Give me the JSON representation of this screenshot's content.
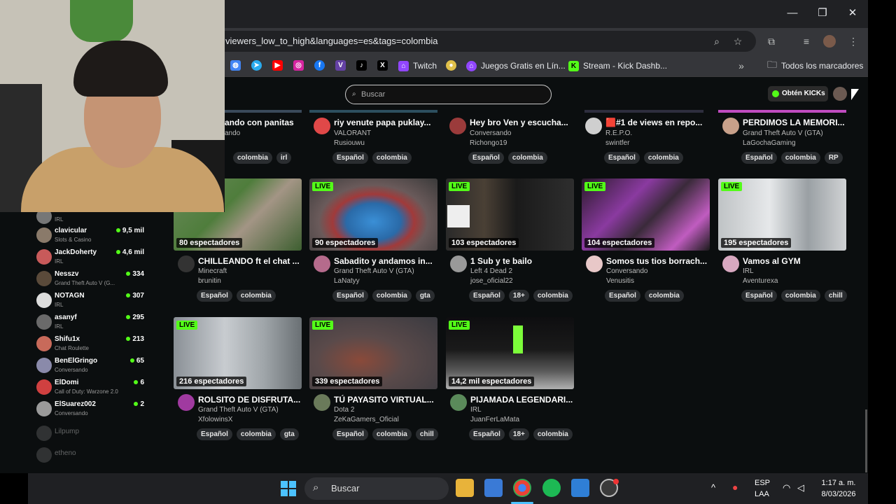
{
  "browser": {
    "url": "viewers_low_to_high&languages=es&tags=colombia",
    "window_controls": {
      "minimize": "—",
      "maximize": "❐",
      "close": "✕"
    },
    "bookmarks": [
      {
        "label": "",
        "icon": "twitch-icon"
      },
      {
        "label": "Twitch",
        "icon": "twitch-icon"
      },
      {
        "label": "Juegos Gratis en Lín...",
        "icon": "games-icon"
      },
      {
        "label": "Stream - Kick Dashb...",
        "icon": "kick-icon"
      }
    ],
    "all_bookmarks_label": "Todos los marcadores"
  },
  "kick": {
    "search_placeholder": "Buscar",
    "get_kicks_label": "Obtén KICKs"
  },
  "sidebar": {
    "channels": [
      {
        "name": "",
        "game": "IRL",
        "viewers": ""
      },
      {
        "name": "clavicular",
        "game": "Slots & Casino",
        "viewers": "9,5 mil"
      },
      {
        "name": "JackDoherty",
        "game": "IRL",
        "viewers": "4,6 mil"
      },
      {
        "name": "Nesszv",
        "game": "Grand Theft Auto V (G...",
        "viewers": "334"
      },
      {
        "name": "NOTAGN",
        "game": "IRL",
        "viewers": "307"
      },
      {
        "name": "asanyf",
        "game": "IRL",
        "viewers": "295"
      },
      {
        "name": "Shifu1x",
        "game": "Chat Roulette",
        "viewers": "213"
      },
      {
        "name": "BenElGringo",
        "game": "Conversando",
        "viewers": "65"
      },
      {
        "name": "ElDomi",
        "game": "Call of Duty: Warzone 2.0",
        "viewers": "6"
      },
      {
        "name": "ElSuarez002",
        "game": "Conversando",
        "viewers": "2"
      },
      {
        "name": "Lilpump",
        "game": "",
        "viewers": ""
      },
      {
        "name": "etheno",
        "game": "",
        "viewers": ""
      }
    ]
  },
  "streams_top": [
    {
      "title": "ando con panitas",
      "game": "ando",
      "user": "",
      "tags": [
        "colombia",
        "irl"
      ]
    },
    {
      "title": "riy venute papa puklay...",
      "game": "VALORANT",
      "user": "Rusiouwu",
      "tags": [
        "Español",
        "colombia"
      ]
    },
    {
      "title": "Hey bro Ven y escucha...",
      "game": "Conversando",
      "user": "Richongo19",
      "tags": [
        "Español",
        "colombia"
      ]
    },
    {
      "title": "🟥#1 de views en repo...",
      "game": "R.E.P.O.",
      "user": "swintfer",
      "tags": [
        "Español",
        "colombia"
      ]
    },
    {
      "title": "PERDIMOS LA MEMORI...",
      "game": "Grand Theft Auto V (GTA)",
      "user": "LaGochaGaming",
      "tags": [
        "Español",
        "colombia",
        "RP"
      ]
    }
  ],
  "streams_row2": [
    {
      "title": "CHILLEANDO ft el chat ...",
      "game": "Minecraft",
      "user": "brunitin",
      "viewers": "80 espectadores",
      "live": "",
      "tags": [
        "Español",
        "colombia"
      ]
    },
    {
      "title": "Sabadito y andamos in...",
      "game": "Grand Theft Auto V (GTA)",
      "user": "LaNatyy",
      "viewers": "90 espectadores",
      "live": "LIVE",
      "tags": [
        "Español",
        "colombia",
        "gta"
      ]
    },
    {
      "title": "1 Sub y te bailo",
      "game": "Left 4 Dead 2",
      "user": "jose_oficial22",
      "viewers": "103 espectadores",
      "live": "LIVE",
      "tags": [
        "Español",
        "18+",
        "colombia"
      ]
    },
    {
      "title": "Somos tus tios borrach...",
      "game": "Conversando",
      "user": "Venusitis",
      "viewers": "104 espectadores",
      "live": "LIVE",
      "tags": [
        "Español",
        "colombia"
      ]
    },
    {
      "title": "Vamos al GYM",
      "game": "IRL",
      "user": "Aventurexa",
      "viewers": "195 espectadores",
      "live": "LIVE",
      "tags": [
        "Español",
        "colombia",
        "chill"
      ]
    }
  ],
  "streams_row3": [
    {
      "title": "ROLSITO DE DISFRUTA...",
      "game": "Grand Theft Auto V (GTA)",
      "user": "XfolowinsX",
      "viewers": "216 espectadores",
      "live": "LIVE",
      "tags": [
        "Español",
        "colombia",
        "gta"
      ]
    },
    {
      "title": "TÚ PAYASITO VIRTUAL...",
      "game": "Dota 2",
      "user": "ZeKaGamers_Oficial",
      "viewers": "339 espectadores",
      "live": "LIVE",
      "tags": [
        "Español",
        "colombia",
        "chill"
      ]
    },
    {
      "title": "PIJAMADA LEGENDARI...",
      "game": "IRL",
      "user": "JuanFerLaMata",
      "viewers": "14,2 mil espectadores",
      "live": "LIVE",
      "tags": [
        "Español",
        "18+",
        "colombia"
      ]
    }
  ],
  "taskbar": {
    "search_label": "Buscar",
    "lang_top": "ESP",
    "lang_bottom": "LAA",
    "time": "1:17 a. m.",
    "date": "8/03/2026"
  }
}
